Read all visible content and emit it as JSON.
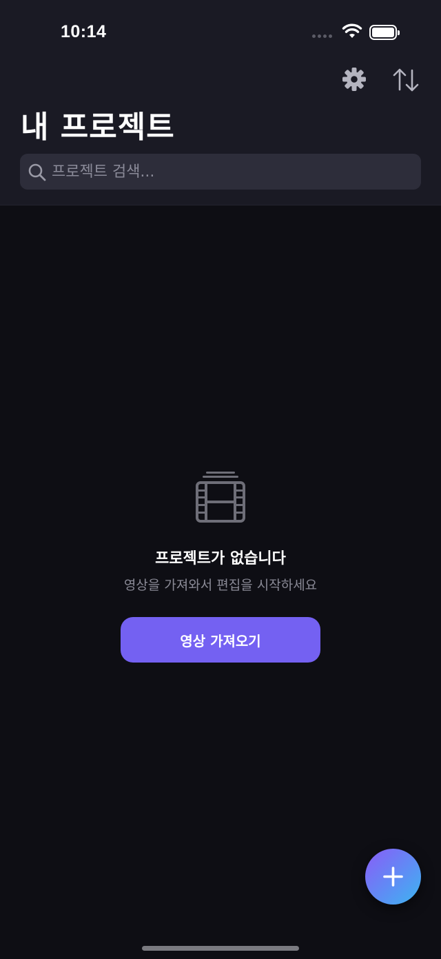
{
  "status_bar": {
    "time": "10:14"
  },
  "toolbar": {
    "settings_icon": "gear-icon",
    "sort_icon": "sort-arrows-icon"
  },
  "header": {
    "title": "내 프로젝트"
  },
  "search": {
    "placeholder": "프로젝트 검색..."
  },
  "empty_state": {
    "icon": "film-strip-icon",
    "title": "프로젝트가 없습니다",
    "subtitle": "영상을 가져와서 편집을 시작하세요",
    "button_label": "영상 가져오기"
  },
  "fab": {
    "icon": "plus-icon"
  },
  "colors": {
    "accent": "#7461f2",
    "background": "#0e0e14",
    "header_background": "#1a1a24",
    "fab_gradient_start": "#8a5cf6",
    "fab_gradient_end": "#3cb6f0"
  }
}
